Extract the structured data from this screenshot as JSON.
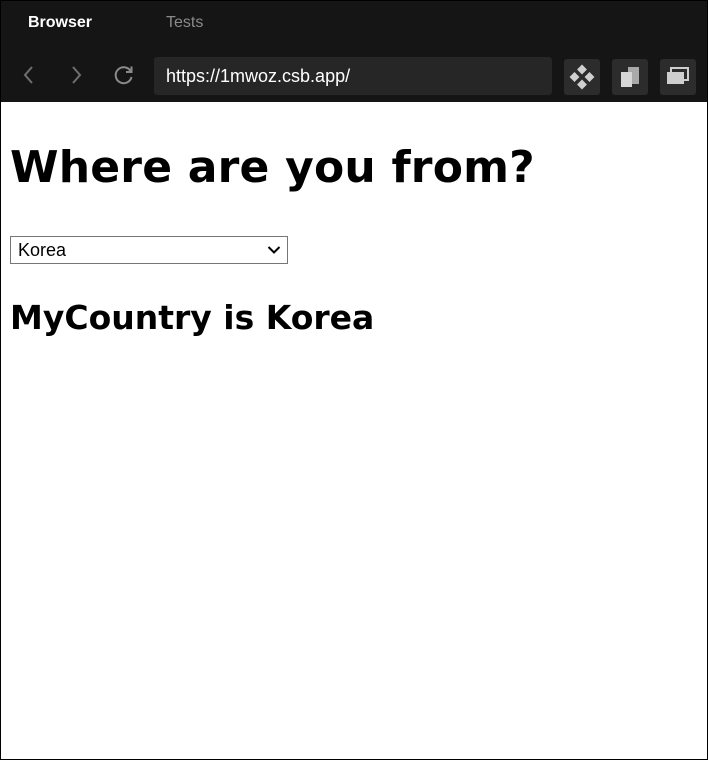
{
  "tabs": [
    {
      "label": "Browser",
      "active": true
    },
    {
      "label": "Tests",
      "active": false
    }
  ],
  "toolbar": {
    "url": "https://1mwoz.csb.app/",
    "buttons": [
      "back-icon",
      "forward-icon",
      "reload-icon",
      "devtools-icon",
      "copy-icon",
      "new-window-icon"
    ]
  },
  "page": {
    "title": "Where are you from?",
    "select": {
      "selected": "Korea"
    },
    "result_prefix": "MyCountry is ",
    "result_country": "Korea"
  },
  "colors": {
    "chrome_bg": "#151515",
    "url_bg": "#262626",
    "tool_btn_bg": "#2c2c2c",
    "inactive_tab": "#8a8a8a"
  }
}
